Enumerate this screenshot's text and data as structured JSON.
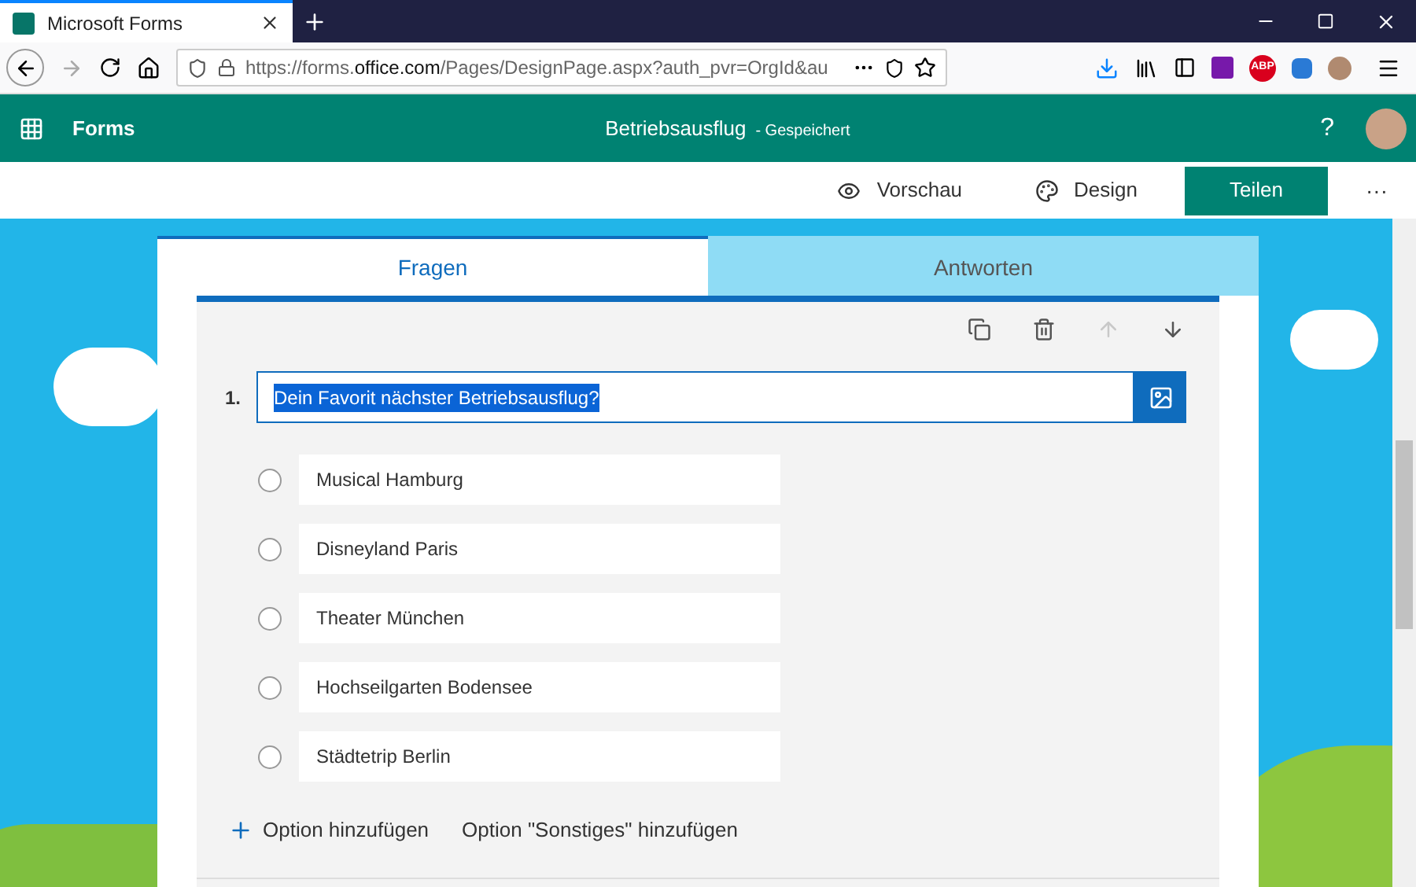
{
  "browser": {
    "tab_title": "Microsoft Forms",
    "url": {
      "host_start": "https://forms.",
      "domain": "office.com",
      "path": "/Pages/DesignPage.aspx?auth_pvr=OrgId&au"
    },
    "extension_badge": "ABP"
  },
  "app_bar": {
    "app_name": "Forms",
    "form_title": "Betriebsausflug",
    "save_state": "- Gespeichert",
    "help": "?"
  },
  "command_bar": {
    "preview": "Vorschau",
    "design": "Design",
    "share": "Teilen",
    "more": "···"
  },
  "tabs": [
    {
      "label": "Fragen",
      "selected": true
    },
    {
      "label": "Antworten",
      "selected": false
    }
  ],
  "question_tools": [
    {
      "kind": "copy",
      "disabled": false
    },
    {
      "kind": "delete",
      "disabled": false
    },
    {
      "kind": "up",
      "disabled": true
    },
    {
      "kind": "down",
      "disabled": false
    }
  ],
  "question": {
    "number": "1.",
    "title": "Dein Favorit nächster Betriebsausflug?",
    "text_selected": true
  },
  "options": [
    {
      "label": "Musical Hamburg",
      "selected": false
    },
    {
      "label": "Disneyland Paris",
      "selected": false
    },
    {
      "label": "Theater München",
      "selected": false
    },
    {
      "label": "Hochseilgarten Bodensee",
      "selected": false
    },
    {
      "label": "Städtetrip Berlin",
      "selected": false
    }
  ],
  "add_option": "Option hinzufügen",
  "add_other": "Option \"Sonstiges\" hinzufügen"
}
